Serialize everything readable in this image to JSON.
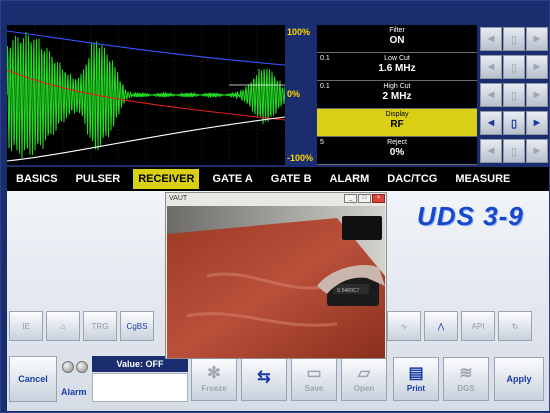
{
  "ascan": {
    "scale_top": "100%",
    "scale_mid": "0%",
    "scale_bottom": "-100%"
  },
  "params": [
    {
      "num": "",
      "label": "Filter",
      "value": "ON"
    },
    {
      "num": "0.1",
      "label": "Low Cut",
      "value": "1.6 MHz"
    },
    {
      "num": "0.1",
      "label": "High Cut",
      "value": "2 MHz"
    },
    {
      "num": "",
      "label": "Display",
      "value": "RF"
    },
    {
      "num": "5",
      "label": "Reject",
      "value": "0%"
    }
  ],
  "menu": [
    "BASICS",
    "PULSER",
    "RECEIVER",
    "GATE A",
    "GATE B",
    "ALARM",
    "DAC/TCG",
    "MEASURE"
  ],
  "active_menu": "RECEIVER",
  "logo": "UDS 3-9",
  "toolbar_left": [
    "IE",
    "",
    "TRG",
    "CgBS"
  ],
  "toolbar_right": [
    "",
    "",
    "API",
    ""
  ],
  "bottom": {
    "cancel": "Cancel",
    "alarm": "Alarm",
    "value_label": "Value: OFF",
    "freeze": "Freeze",
    "save": "Save",
    "open": "Open",
    "print": "Print",
    "dgs": "DGS",
    "apply": "Apply"
  },
  "overlay": {
    "title": "VAUT",
    "device_label": "S 5480C7"
  },
  "colors": {
    "background": "#1a2d6e",
    "highlight": "#d9cf14",
    "signal": "#22dd22",
    "curve_blue": "#3a52ff",
    "curve_red": "#e02020",
    "curve_white": "#ffffff"
  }
}
